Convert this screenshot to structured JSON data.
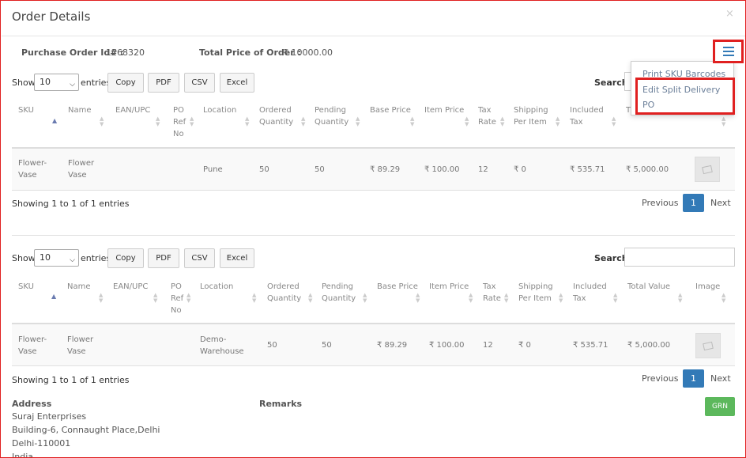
{
  "modal": {
    "title": "Order Details",
    "close_glyph": "×"
  },
  "order": {
    "po_id_label": "Purchase Order Id# :",
    "po_id_value": "1268320",
    "total_label": "Total Price of Order :",
    "total_value": "₹ 10000.00"
  },
  "menu": {
    "icon": "hamburger-icon",
    "items": [
      "Print SKU Barcodes",
      "Edit Split Delivery",
      "PO"
    ]
  },
  "controls": {
    "show_label": "Show",
    "entries_value": "10",
    "entries_label": "entries",
    "buttons": [
      "Copy",
      "PDF",
      "CSV",
      "Excel"
    ],
    "search_label": "Search:"
  },
  "table1": {
    "headers": [
      [
        "SKU"
      ],
      [
        "Name"
      ],
      [
        "EAN/UPC"
      ],
      [
        "PO",
        "Ref",
        "No"
      ],
      [
        "Location"
      ],
      [
        "Ordered",
        "Quantity"
      ],
      [
        "Pending",
        "Quantity"
      ],
      [
        "Base Price"
      ],
      [
        "Item Price"
      ],
      [
        "Tax",
        "Rate"
      ],
      [
        "Shipping",
        "Per Item"
      ],
      [
        "Included",
        "Tax"
      ],
      [
        "T"
      ]
    ],
    "row": {
      "sku": [
        "Flower-",
        "Vase"
      ],
      "name": [
        "Flower",
        "Vase"
      ],
      "ean": "",
      "po_ref": "",
      "location": [
        "Pune"
      ],
      "ordered": "50",
      "pending": "50",
      "base_price": "₹ 89.29",
      "item_price": "₹ 100.00",
      "tax_rate": "12",
      "shipping": "₹ 0",
      "included_tax": "₹ 535.71",
      "total_value": "₹ 5,000.00"
    },
    "info": "Showing 1 to 1 of 1 entries",
    "pagination": {
      "previous": "Previous",
      "current": "1",
      "next": "Next"
    }
  },
  "table2": {
    "headers": [
      [
        "SKU"
      ],
      [
        "Name"
      ],
      [
        "EAN/UPC"
      ],
      [
        "PO",
        "Ref",
        "No"
      ],
      [
        "Location"
      ],
      [
        "Ordered",
        "Quantity"
      ],
      [
        "Pending",
        "Quantity"
      ],
      [
        "Base Price"
      ],
      [
        "Item Price"
      ],
      [
        "Tax",
        "Rate"
      ],
      [
        "Shipping",
        "Per Item"
      ],
      [
        "Included",
        "Tax"
      ],
      [
        "Total Value"
      ],
      [
        "Image"
      ]
    ],
    "row": {
      "sku": [
        "Flower-",
        "Vase"
      ],
      "name": [
        "Flower",
        "Vase"
      ],
      "ean": "",
      "po_ref": "",
      "location": [
        "Demo-",
        "Warehouse"
      ],
      "ordered": "50",
      "pending": "50",
      "base_price": "₹ 89.29",
      "item_price": "₹ 100.00",
      "tax_rate": "12",
      "shipping": "₹ 0",
      "included_tax": "₹ 535.71",
      "total_value": "₹ 5,000.00"
    },
    "info": "Showing 1 to 1 of 1 entries",
    "pagination": {
      "previous": "Previous",
      "current": "1",
      "next": "Next"
    }
  },
  "address": {
    "title": "Address",
    "lines": [
      "Suraj Enterprises",
      "Building-6, Connaught Place,Delhi",
      "Delhi-110001",
      "India"
    ]
  },
  "remarks": {
    "title": "Remarks"
  },
  "grn_button": "GRN",
  "colors": {
    "highlight": "#e02020",
    "primary": "#337ab7",
    "success": "#5cb85c"
  }
}
